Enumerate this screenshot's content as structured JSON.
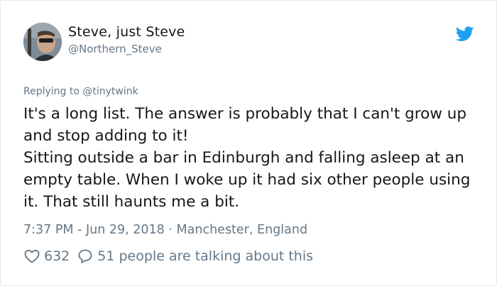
{
  "author": {
    "display_name": "Steve, just Steve",
    "handle": "@Northern_Steve"
  },
  "reply_context": {
    "prefix": "Replying to",
    "mention": "@tinytwink"
  },
  "tweet": {
    "paragraphs": [
      "It's a long list. The answer is probably that I can't grow up and stop adding to it!",
      "Sitting outside a bar in Edinburgh and falling asleep at an empty table. When I woke up it had six other people using it. That still haunts me a bit."
    ],
    "time": "7:37 PM",
    "date": "Jun 29, 2018",
    "location": "Manchester, England"
  },
  "engagement": {
    "likes": "632",
    "talking_text": "51 people are talking about this"
  },
  "icons": {
    "brand": "twitter-bird-icon",
    "like": "heart-icon",
    "reply": "speech-bubble-icon"
  },
  "colors": {
    "brand_blue": "#1da1f2",
    "text_primary": "#14171a",
    "text_secondary": "#657786",
    "border": "#e1e8ed"
  }
}
